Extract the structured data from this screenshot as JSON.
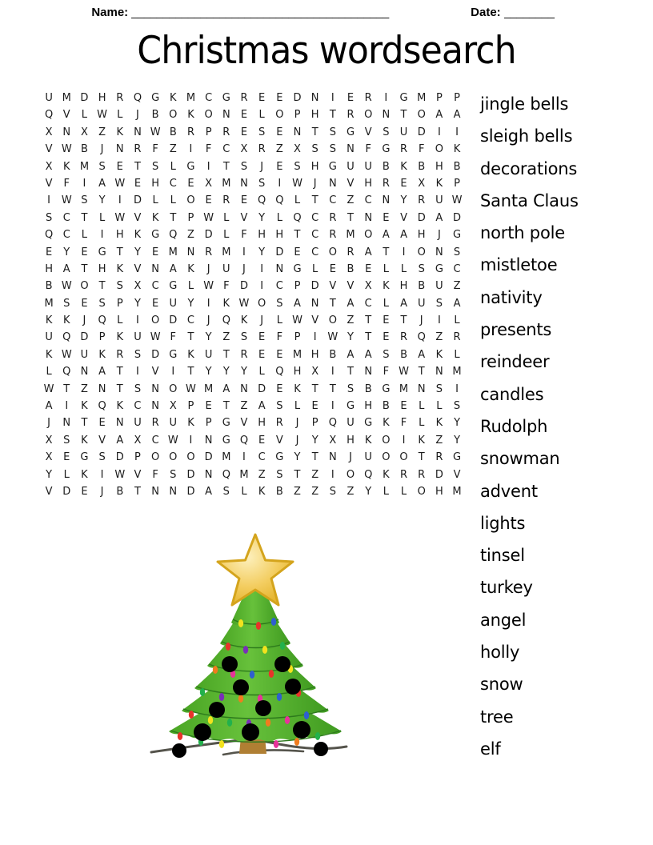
{
  "header": {
    "name_label": "Name:",
    "name_blank": "_________________________________________",
    "date_label": "Date:",
    "date_blank": "________"
  },
  "title": "Christmas wordsearch",
  "puzzle": {
    "rows": 24,
    "cols": 22,
    "grid": [
      "UMDHRQGKMCGREEDNIERIGMPP",
      "QVLWLJBOKONELOPHTRONTOAA",
      "XNXZKNWBRPRESENTSGVSUDII",
      "VWBJNRFZIFCXRZXSSNFGRFOK",
      "XKMSETSLGITSJESHGUUBKBHB",
      "VFIAWEHCEXMNSIWJNVHREXKP",
      "IWSYIDLLOEREQQLTCZCNYRUW",
      "SCTLWVKTPWLVYLQCRTNEVDAD",
      "QCLIHKGQZDLFHHTCRMOAAHJG",
      "EYEGTYEMNRMIYDECORATIONS",
      "HATHKVNAKJUJINGLEBELLSGC",
      "BWOTSXCGLWFDICPDVVXKHBUZ",
      "MSESPYEUYIKWOSANTACLAUSA",
      "KKJQLIODCJQKJLWVOZTETJIL",
      "UQDPKUWFTYZSEFPIWYTERQZR",
      "KWUKRSDGKUTREEMHBAASBAKL",
      "LQNATIVITYYYLQHXITNFWTNM",
      "WTZNTSNOWMANDEKTTSBGMNSI",
      "AIKQKCNXPETZASLEIGHBELLS",
      "JNTENURUKPGVHRJPQUGKFLKY",
      "XSKVAXCWINGQEVJYXHKOIKZY",
      "XEGSDPOOODMICGYTNJUOOTRG",
      "YLKIWVFSDNQMZSTZIOQKRRDV",
      "VDEJBTNNDASLKBZZSZYLLOHM"
    ]
  },
  "wordlist": {
    "words": [
      "jingle bells",
      "sleigh bells",
      "decorations",
      "Santa Claus",
      "north pole",
      "mistletoe",
      "nativity",
      "presents",
      "reindeer",
      "candles",
      "Rudolph",
      "snowman",
      "advent",
      "lights",
      "tinsel",
      "turkey",
      "angel",
      "holly",
      "snow",
      "tree",
      "elf"
    ]
  },
  "illustration": {
    "name": "christmas-tree",
    "colors": {
      "star_fill": "#f5d36a",
      "star_stroke": "#d4a41c",
      "foliage_dark": "#3f9a20",
      "foliage_mid": "#55b830",
      "foliage_light": "#6cc63f",
      "trunk": "#a9762f",
      "ornament": "#000000",
      "ground": "#4a4a42"
    },
    "light_colors": [
      "#e8332a",
      "#f2b01e",
      "#2f5fd0",
      "#7a2fb8",
      "#22b14c",
      "#e8329a",
      "#f07c1e",
      "#f2e21e"
    ]
  }
}
